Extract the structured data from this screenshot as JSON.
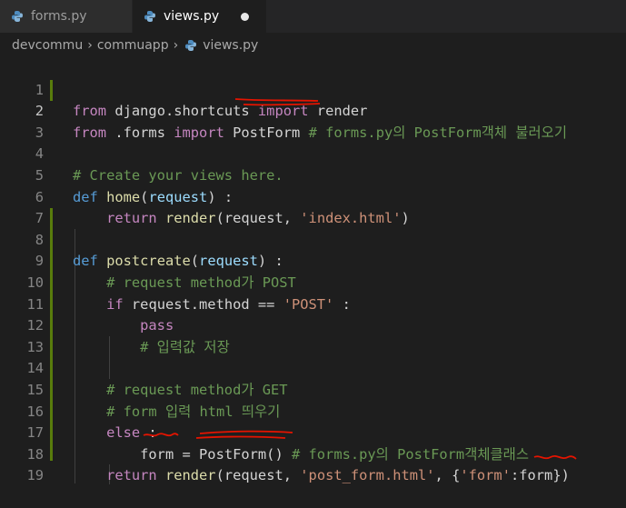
{
  "tabs": [
    {
      "label": "forms.py",
      "active": false,
      "dirty": false
    },
    {
      "label": "views.py",
      "active": true,
      "dirty": true
    }
  ],
  "breadcrumb": {
    "items": [
      "devcommu",
      "commuapp",
      "views.py"
    ]
  },
  "code": {
    "line_numbers": [
      "1",
      "2",
      "3",
      "4",
      "5",
      "6",
      "7",
      "8",
      "9",
      "10",
      "11",
      "12",
      "13",
      "14",
      "15",
      "16",
      "17",
      "18",
      "19"
    ],
    "l1": {
      "from": "from",
      "mod": "django.shortcuts",
      "import": "import",
      "name": "render"
    },
    "l2": {
      "from": "from",
      "mod": ".forms",
      "import": "import",
      "name": "PostForm",
      "comment": "# forms.py의 PostForm객체 불러오기"
    },
    "l4": {
      "comment": "# Create your views here."
    },
    "l5": {
      "def": "def",
      "fname": "home",
      "open": "(",
      "param": "request",
      "close": ") :"
    },
    "l6": {
      "ret": "return",
      "call": "render",
      "open": "(",
      "arg": "request",
      "comma": ", ",
      "str": "'index.html'",
      "close": ")"
    },
    "l8": {
      "def": "def",
      "fname": "postcreate",
      "open": "(",
      "param": "request",
      "close": ") :"
    },
    "l9": {
      "comment": "# request method가 POST"
    },
    "l10": {
      "if": "if",
      "expr": "request.method == ",
      "str": "'POST'",
      "tail": " :"
    },
    "l11": {
      "pass": "pass"
    },
    "l12": {
      "comment": "# 입력값 저장"
    },
    "l14": {
      "comment": "# request method가 GET"
    },
    "l15": {
      "comment": "# form 입력 html 띄우기"
    },
    "l16": {
      "else": "else",
      "tail": " :"
    },
    "l17": {
      "var": "form",
      "eq": " = ",
      "cls": "PostForm",
      "call": "()",
      "comment": " # forms.py의 PostForm객체클래스"
    },
    "l18": {
      "ret": "return",
      "call": "render",
      "open": "(",
      "arg": "request",
      "comma": ", ",
      "str": "'post_form.html'",
      "mid": ", {",
      "key": "'form'",
      "colon": ":",
      "val": "form",
      "close": "})"
    }
  },
  "colors": {
    "background": "#1e1e1e",
    "keyword": "#569cd6",
    "control": "#c586c0",
    "function": "#dcdcaa",
    "variable": "#9cdcfe",
    "string": "#ce9178",
    "comment": "#6a9955",
    "annotation": "#e51400"
  },
  "icons": {
    "tab_icon": "python-file-icon",
    "breadcrumb_sep": "chevron-right-icon",
    "dirty": "unsaved-dot-icon"
  }
}
